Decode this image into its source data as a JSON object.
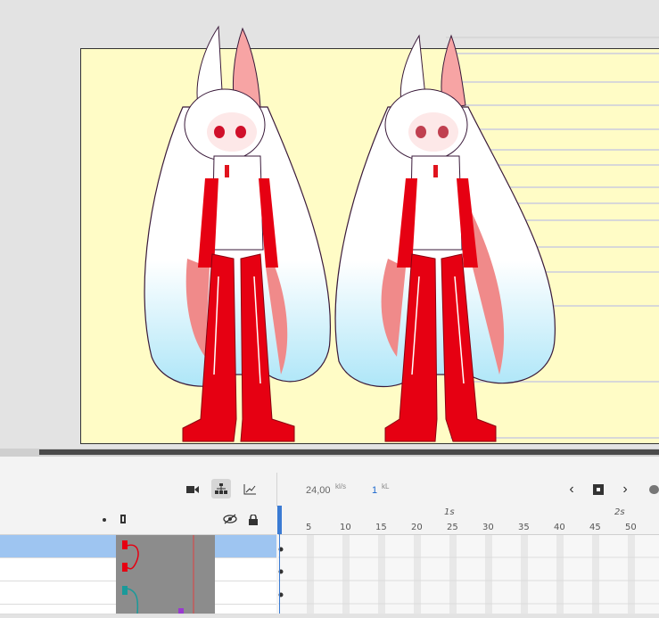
{
  "timeline": {
    "fps_value": "24,00",
    "fps_unit": "kl/s",
    "frame_value": "1",
    "frame_unit": "kL",
    "ruler_ticks": [
      "5",
      "10",
      "15",
      "20",
      "25",
      "30",
      "35",
      "40",
      "45",
      "50"
    ],
    "time_markers": [
      "1s",
      "2s"
    ],
    "toolbar_icons": [
      "camera-icon",
      "layer-hierarchy-icon",
      "graph-icon"
    ],
    "nav_icons": [
      "prev-frame-icon",
      "keyframe-icon",
      "next-frame-icon",
      "onion-skin-icon"
    ],
    "layer_header_icons": [
      "dot-icon",
      "outline-icon",
      "visibility-icon",
      "lock-icon"
    ]
  },
  "colors": {
    "canvas_bg": "#fffcc6",
    "selected_layer": "#9ec5f1",
    "playhead": "#3b7bd3",
    "frame_number": "#1a66cc"
  }
}
